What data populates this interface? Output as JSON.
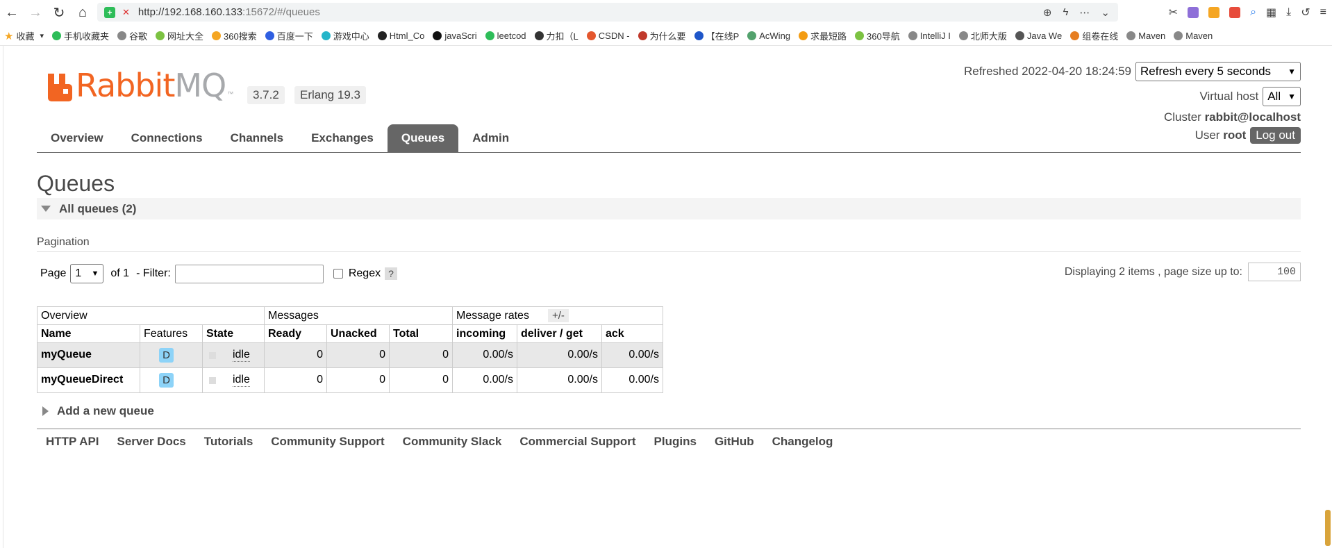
{
  "browser": {
    "url_host": "http://192.168.160.133",
    "url_rest": ":15672/#/queues",
    "bookmarks": [
      {
        "label": "收藏",
        "color": "#f5a623"
      },
      {
        "label": "手机收藏夹",
        "color": "#2ebd59"
      },
      {
        "label": "谷歌",
        "color": "#888888"
      },
      {
        "label": "网址大全",
        "color": "#7cc242"
      },
      {
        "label": "360搜索",
        "color": "#f5a623"
      },
      {
        "label": "百度一下",
        "color": "#2f5fe1"
      },
      {
        "label": "游戏中心",
        "color": "#26b5c9"
      },
      {
        "label": "Html_Co",
        "color": "#222222"
      },
      {
        "label": "javaScri",
        "color": "#111111"
      },
      {
        "label": "leetcod",
        "color": "#2ebd59"
      },
      {
        "label": "力扣（L",
        "color": "#333333"
      },
      {
        "label": "CSDN -",
        "color": "#e4572e"
      },
      {
        "label": "为什么要",
        "color": "#c0392b"
      },
      {
        "label": "【在线P",
        "color": "#1e56c9"
      },
      {
        "label": "AcWing",
        "color": "#53a26d"
      },
      {
        "label": "求最短路",
        "color": "#f39c12"
      },
      {
        "label": "360导航",
        "color": "#7cc242"
      },
      {
        "label": "IntelliJ I",
        "color": "#888888"
      },
      {
        "label": "北师大版",
        "color": "#888888"
      },
      {
        "label": "Java We",
        "color": "#555555"
      },
      {
        "label": "组卷在线",
        "color": "#e67e22"
      },
      {
        "label": "Maven",
        "color": "#888888"
      },
      {
        "label": "Maven",
        "color": "#888888"
      }
    ]
  },
  "header": {
    "version": "3.7.2",
    "erlang": "Erlang 19.3",
    "refreshed_label": "Refreshed",
    "refreshed_time": "2022-04-20 18:24:59",
    "refresh_option": "Refresh every 5 seconds",
    "vhost_label": "Virtual host",
    "vhost_value": "All",
    "cluster_label": "Cluster",
    "cluster_value": "rabbit@localhost",
    "user_label": "User",
    "user_value": "root",
    "logout": "Log out"
  },
  "tabs": [
    "Overview",
    "Connections",
    "Channels",
    "Exchanges",
    "Queues",
    "Admin"
  ],
  "page": {
    "title": "Queues",
    "section": "All queues (2)",
    "pagination_label": "Pagination",
    "page_label": "Page",
    "page_value": "1",
    "of_label": "of 1",
    "filter_label": "- Filter:",
    "regex_label": "Regex",
    "help": "?",
    "displaying": "Displaying 2 items , page size up to:",
    "page_size": "100",
    "plusminus": "+/-",
    "add_queue": "Add a new queue"
  },
  "table": {
    "groups": [
      "Overview",
      "Messages",
      "Message rates"
    ],
    "headers": [
      "Name",
      "Features",
      "State",
      "Ready",
      "Unacked",
      "Total",
      "incoming",
      "deliver / get",
      "ack"
    ],
    "rows": [
      {
        "name": "myQueue",
        "feature": "D",
        "state": "idle",
        "ready": "0",
        "unacked": "0",
        "total": "0",
        "incoming": "0.00/s",
        "deliver": "0.00/s",
        "ack": "0.00/s"
      },
      {
        "name": "myQueueDirect",
        "feature": "D",
        "state": "idle",
        "ready": "0",
        "unacked": "0",
        "total": "0",
        "incoming": "0.00/s",
        "deliver": "0.00/s",
        "ack": "0.00/s"
      }
    ]
  },
  "footer": [
    "HTTP API",
    "Server Docs",
    "Tutorials",
    "Community Support",
    "Community Slack",
    "Commercial Support",
    "Plugins",
    "GitHub",
    "Changelog"
  ],
  "colors": {
    "rabbit_orange": "#f26522",
    "tab_active": "#666666",
    "durable_badge": "#8dd3f8"
  }
}
